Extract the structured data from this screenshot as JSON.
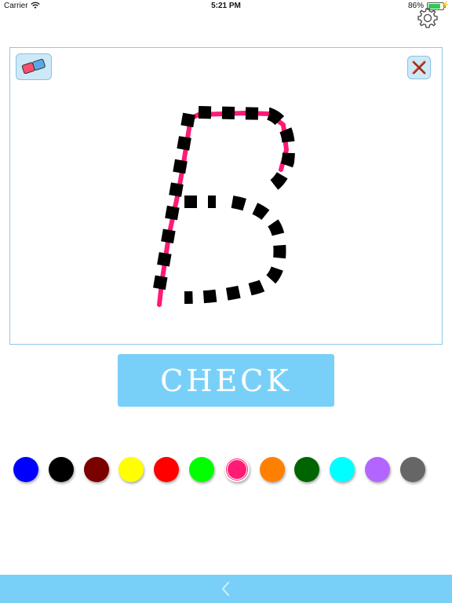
{
  "status_bar": {
    "carrier": "Carrier",
    "time": "5:21 PM",
    "battery_percent": "86%",
    "battery_level": 0.86
  },
  "toolbar": {
    "settings_icon": "gear-icon",
    "eraser_icon": "eraser-icon",
    "clear_icon": "close-x-icon"
  },
  "canvas": {
    "trace_letter": "B",
    "stroke_color": "#ff1a75",
    "guide_color": "#000000"
  },
  "check_button": {
    "label": "CHECK"
  },
  "palette": {
    "colors": [
      "#0000ff",
      "#000000",
      "#7b0000",
      "#ffff00",
      "#ff0000",
      "#00ff00",
      "#ff1a75",
      "#ff8000",
      "#006400",
      "#00ffff",
      "#b266ff",
      "#666666"
    ],
    "selected": "#ff1a75"
  },
  "bottom_bar": {
    "back_icon": "chevron-left-icon",
    "color": "#78d0f8"
  }
}
